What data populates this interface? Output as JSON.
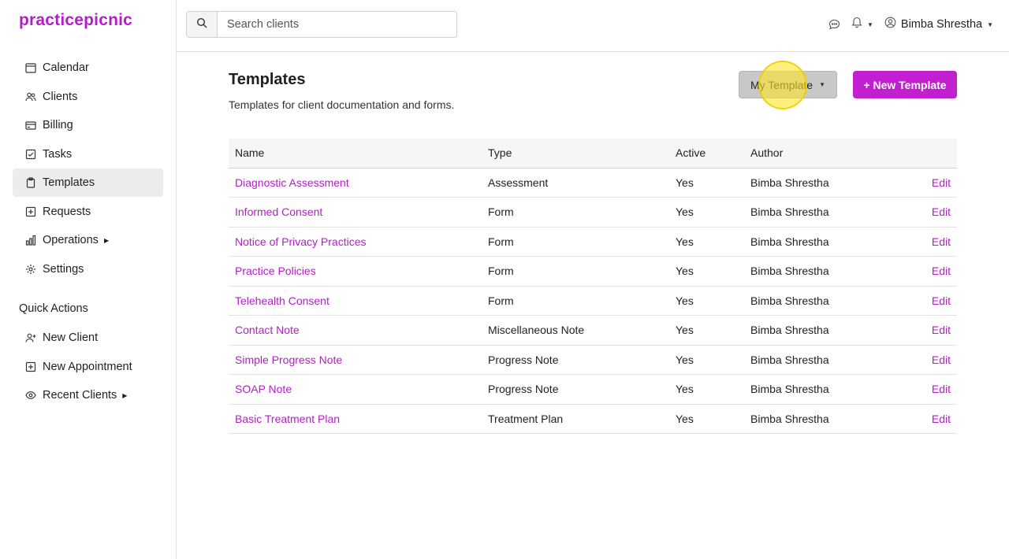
{
  "brand": "practicepicnic",
  "sidebar": {
    "items": [
      {
        "label": "Calendar",
        "icon": "calendar-icon"
      },
      {
        "label": "Clients",
        "icon": "users-icon"
      },
      {
        "label": "Billing",
        "icon": "credit-card-icon"
      },
      {
        "label": "Tasks",
        "icon": "checkbox-icon"
      },
      {
        "label": "Templates",
        "icon": "clipboard-icon",
        "active": true
      },
      {
        "label": "Requests",
        "icon": "plus-square-icon"
      },
      {
        "label": "Operations",
        "icon": "bar-chart-icon",
        "has_submenu": true
      },
      {
        "label": "Settings",
        "icon": "gear-icon"
      }
    ],
    "quick_actions_title": "Quick Actions",
    "quick_actions": [
      {
        "label": "New Client",
        "icon": "user-plus-icon"
      },
      {
        "label": "New Appointment",
        "icon": "plus-square-icon"
      },
      {
        "label": "Recent Clients",
        "icon": "eye-icon",
        "has_submenu": true
      }
    ]
  },
  "topbar": {
    "search_placeholder": "Search clients",
    "user_name": "Bimba Shrestha"
  },
  "page": {
    "title": "Templates",
    "subtitle": "Templates for client documentation and forms.",
    "filter_button": "My Template",
    "new_button": "+ New Template"
  },
  "table": {
    "headers": [
      "Name",
      "Type",
      "Active",
      "Author",
      ""
    ],
    "rows": [
      {
        "name": "Diagnostic Assessment",
        "type": "Assessment",
        "active": "Yes",
        "author": "Bimba Shrestha",
        "action": "Edit"
      },
      {
        "name": "Informed Consent",
        "type": "Form",
        "active": "Yes",
        "author": "Bimba Shrestha",
        "action": "Edit"
      },
      {
        "name": "Notice of Privacy Practices",
        "type": "Form",
        "active": "Yes",
        "author": "Bimba Shrestha",
        "action": "Edit"
      },
      {
        "name": "Practice Policies",
        "type": "Form",
        "active": "Yes",
        "author": "Bimba Shrestha",
        "action": "Edit"
      },
      {
        "name": "Telehealth Consent",
        "type": "Form",
        "active": "Yes",
        "author": "Bimba Shrestha",
        "action": "Edit"
      },
      {
        "name": "Contact Note",
        "type": "Miscellaneous Note",
        "active": "Yes",
        "author": "Bimba Shrestha",
        "action": "Edit"
      },
      {
        "name": "Simple Progress Note",
        "type": "Progress Note",
        "active": "Yes",
        "author": "Bimba Shrestha",
        "action": "Edit"
      },
      {
        "name": "SOAP Note",
        "type": "Progress Note",
        "active": "Yes",
        "author": "Bimba Shrestha",
        "action": "Edit"
      },
      {
        "name": "Basic Treatment Plan",
        "type": "Treatment Plan",
        "active": "Yes",
        "author": "Bimba Shrestha",
        "action": "Edit"
      }
    ]
  },
  "colors": {
    "accent": "#c21fd0",
    "link": "#b31ec8",
    "active_nav_bg": "#ececec"
  }
}
